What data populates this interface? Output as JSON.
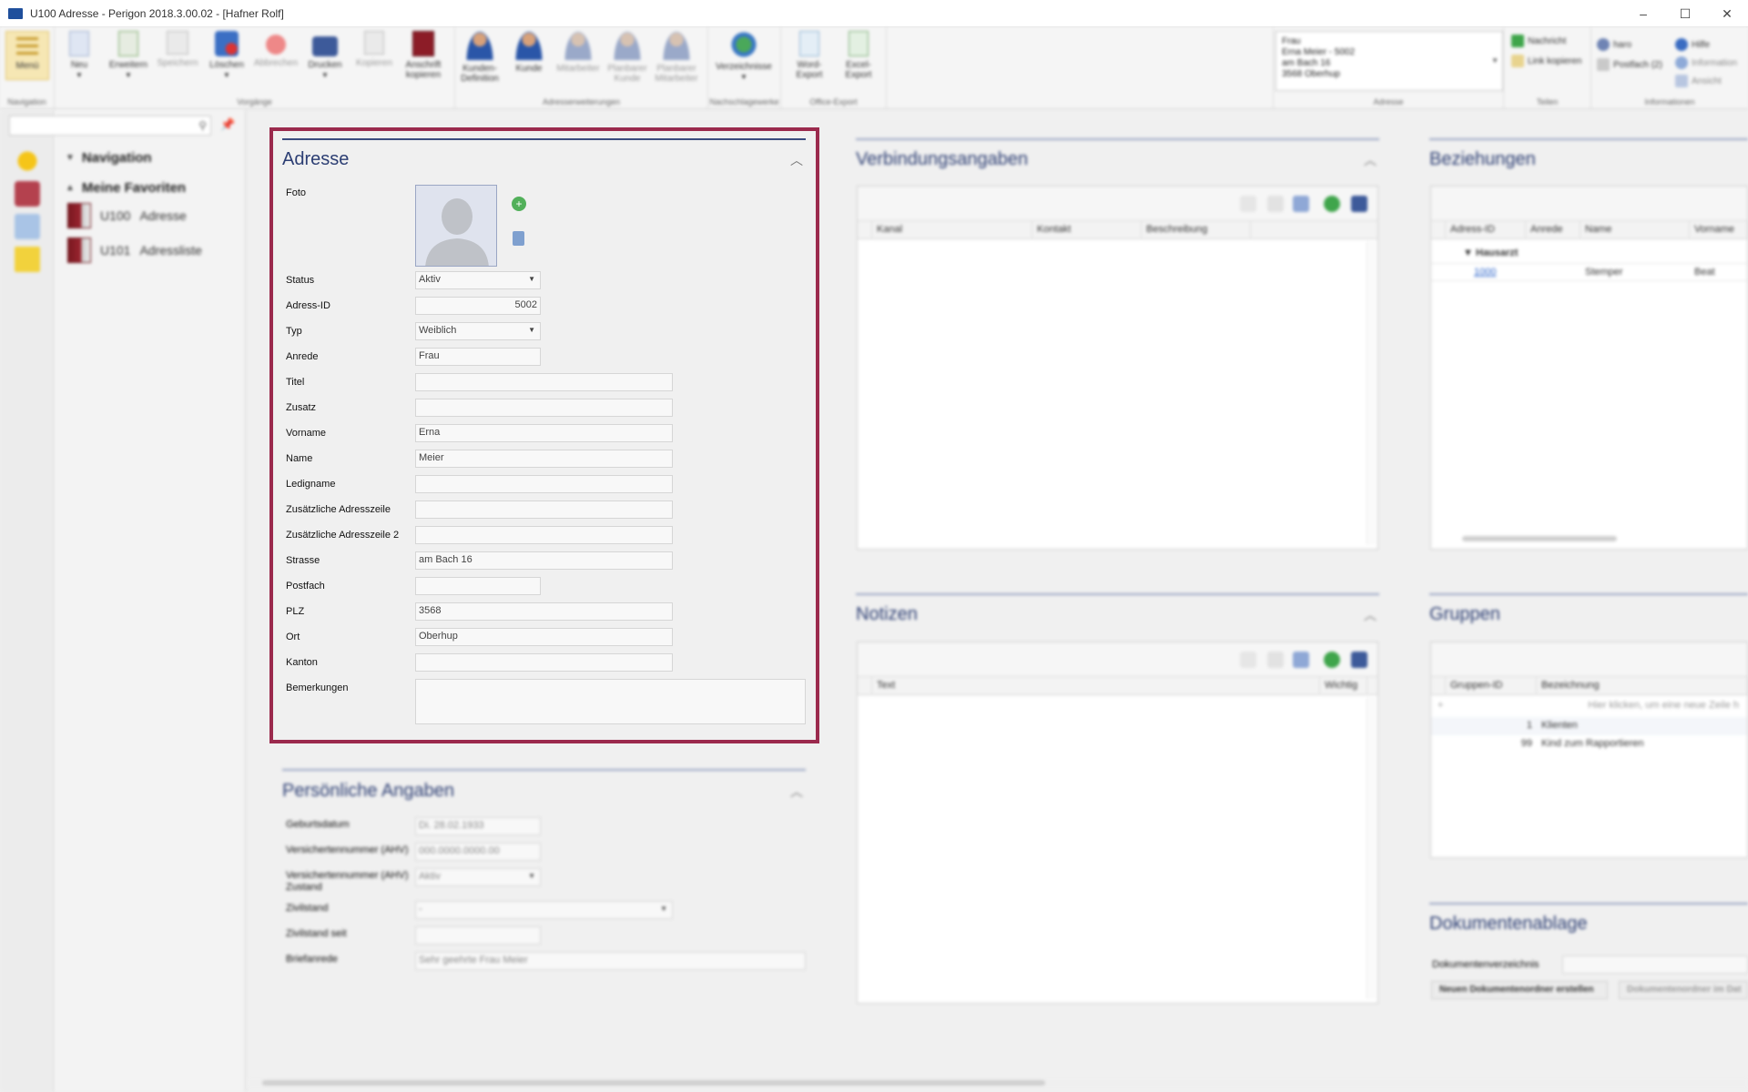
{
  "window": {
    "title": "U100 Adresse  -  Perigon 2018.3.00.02  -  [Hafner Rolf]",
    "controls": [
      "–",
      "☐",
      "✕"
    ]
  },
  "ribbon": {
    "groups": {
      "navigation": "Navigation",
      "vorgaenge": "Vorgänge",
      "adresserweiterungen": "Adresserweiterungen",
      "nachschlagewerke": "Nachschlagewerke",
      "office_export": "Office-Export",
      "adresse": "Adresse",
      "teilen": "Teilen",
      "informationen": "Informationen"
    },
    "buttons": {
      "menu": "Menü",
      "neu": "Neu",
      "erweitern": "Erweitern",
      "speichern": "Speichern",
      "loeschen": "Löschen",
      "abbrechen": "Abbrechen",
      "drucken": "Drucken",
      "kopieren": "Kopieren",
      "anschrift_1": "Anschrift",
      "anschrift_2": "kopieren",
      "kunden_def_1": "Kunden-",
      "kunden_def_2": "Definition",
      "kunde": "Kunde",
      "mitarbeiter": "Mitarbeiter",
      "planbarer_kunde_1": "Planbarer",
      "planbarer_kunde_2": "Kunde",
      "planbarer_ma_1": "Planbarer",
      "planbarer_ma_2": "Mitarbeiter",
      "verzeichnisse": "Verzeichnisse",
      "word_1": "Word-",
      "word_2": "Export",
      "excel_1": "Excel-",
      "excel_2": "Export",
      "nachricht": "Nachricht",
      "link_kopieren": "Link kopieren",
      "user": "haro",
      "postfach": "Postfach (2)",
      "hilfe": "Hilfe",
      "information": "Information",
      "ansicht": "Ansicht"
    },
    "address_box": {
      "line1": "Frau",
      "line2": "Erna Meier - 5002",
      "line3": "am Bach 16",
      "line4": "3568 Oberhup"
    }
  },
  "sidebar": {
    "search_placeholder": "",
    "navigation_heading": "Navigation",
    "favorites_heading": "Meine Favoriten",
    "favorites": [
      {
        "code": "U100",
        "label": "Adresse"
      },
      {
        "code": "U101",
        "label": "Adressliste"
      }
    ]
  },
  "adresse": {
    "title": "Adresse",
    "fields": {
      "foto": "Foto",
      "status": {
        "label": "Status",
        "value": "Aktiv"
      },
      "adress_id": {
        "label": "Adress-ID",
        "value": "5002"
      },
      "typ": {
        "label": "Typ",
        "value": "Weiblich"
      },
      "anrede": {
        "label": "Anrede",
        "value": "Frau"
      },
      "titel": {
        "label": "Titel",
        "value": ""
      },
      "zusatz": {
        "label": "Zusatz",
        "value": ""
      },
      "vorname": {
        "label": "Vorname",
        "value": "Erna"
      },
      "name": {
        "label": "Name",
        "value": "Meier"
      },
      "ledigname": {
        "label": "Ledigname",
        "value": ""
      },
      "zusatz_adresszeile": {
        "label": "Zusätzliche Adresszeile",
        "value": ""
      },
      "zusatz_adresszeile2": {
        "label": "Zusätzliche Adresszeile 2",
        "value": ""
      },
      "strasse": {
        "label": "Strasse",
        "value": "am Bach 16"
      },
      "postfach": {
        "label": "Postfach",
        "value": ""
      },
      "plz": {
        "label": "PLZ",
        "value": "3568"
      },
      "ort": {
        "label": "Ort",
        "value": "Oberhup"
      },
      "kanton": {
        "label": "Kanton",
        "value": ""
      },
      "bemerkungen": {
        "label": "Bemerkungen",
        "value": ""
      }
    }
  },
  "persoenlich": {
    "title": "Persönliche Angaben",
    "fields": {
      "geburtsdatum": {
        "label": "Geburtsdatum",
        "value": "Di. 28.02.1933"
      },
      "ahv": {
        "label": "Versichertennummer (AHV)",
        "value": "000.0000.0000.00"
      },
      "ahv_zustand_1": "Versichertennummer (AHV)",
      "ahv_zustand_2": "Zustand",
      "ahv_zustand_value": "Aktiv",
      "zivilstand": {
        "label": "Zivilstand",
        "value": "-"
      },
      "zivilstand_seit": {
        "label": "Zivilstand seit",
        "value": ""
      },
      "briefanrede": {
        "label": "Briefanrede",
        "value": "Sehr geehrte Frau Meier"
      }
    }
  },
  "verbindung": {
    "title": "Verbindungsangaben",
    "columns": [
      "Kanal",
      "Kontakt",
      "Beschreibung"
    ]
  },
  "notizen": {
    "title": "Notizen",
    "columns": [
      "Text",
      "Wichtig"
    ]
  },
  "beziehungen": {
    "title": "Beziehungen",
    "columns": [
      "Adress-ID",
      "Anrede",
      "Name",
      "Vorname"
    ],
    "group": "Hausarzt",
    "rows": [
      {
        "id": "1000",
        "anrede": "",
        "name": "Stemper",
        "vorname": "Beat"
      }
    ]
  },
  "gruppen": {
    "title": "Gruppen",
    "columns": [
      "Gruppen-ID",
      "Bezeichnung"
    ],
    "new_row_hint": "Hier klicken, um eine neue Zeile h",
    "rows": [
      {
        "id": "1",
        "bezeichnung": "Klienten"
      },
      {
        "id": "99",
        "bezeichnung": "Kind zum Rapportieren"
      }
    ]
  },
  "dokumente": {
    "title": "Dokumentenablage",
    "label": "Dokumentenverzeichnis",
    "btn_new": "Neuen Dokumentenordner erstellen",
    "btn_open": "Dokumentenordner im Dat"
  }
}
